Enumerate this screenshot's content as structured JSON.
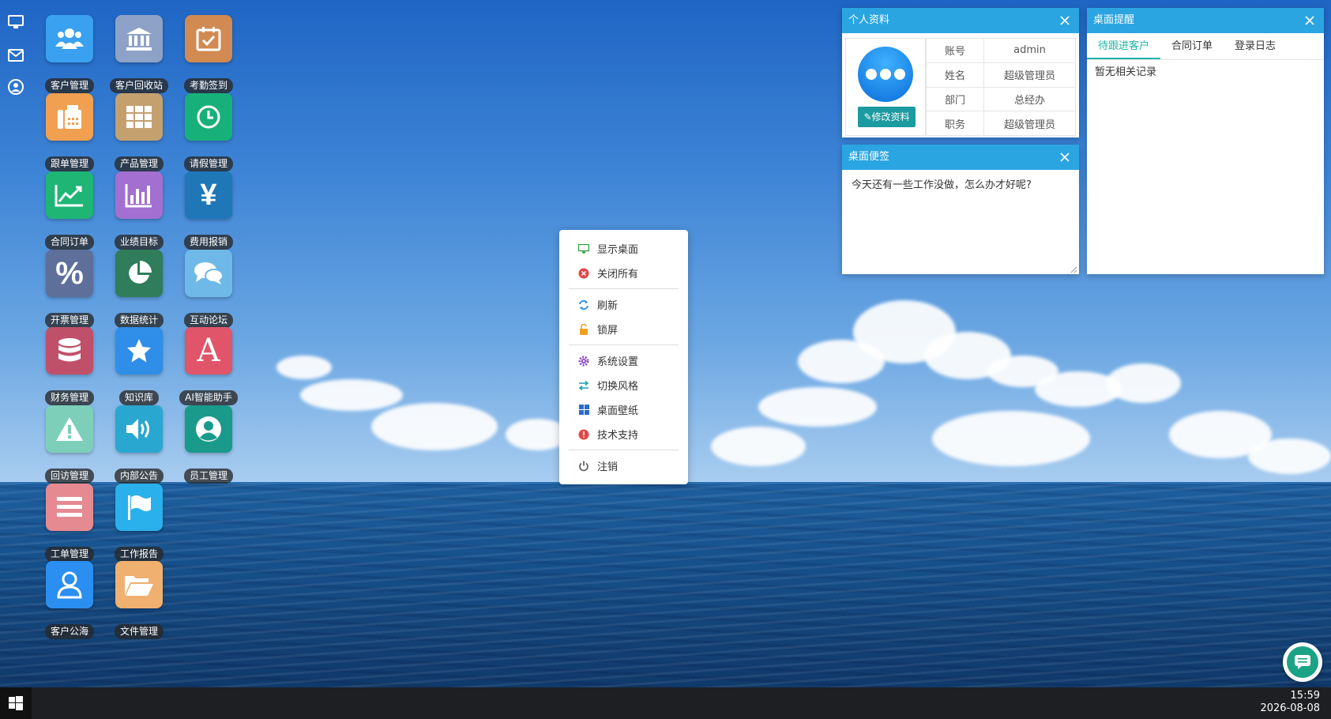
{
  "desktop": {
    "icons": [
      {
        "label": "客户管理",
        "icon": "users-icon",
        "color": "#3aa0f0"
      },
      {
        "label": "客户回收站",
        "icon": "bank-icon",
        "color": "#8ea2c7"
      },
      {
        "label": "考勤签到",
        "icon": "calendar-check-icon",
        "color": "#d08a52"
      },
      {
        "label": "跟单管理",
        "icon": "fax-icon",
        "color": "#f0a050"
      },
      {
        "label": "产品管理",
        "icon": "grid-icon",
        "color": "#c4a06f"
      },
      {
        "label": "请假管理",
        "icon": "clock-icon",
        "color": "#18b07a"
      },
      {
        "label": "合同订单",
        "icon": "line-chart-icon",
        "color": "#1fb575"
      },
      {
        "label": "业绩目标",
        "icon": "bar-chart-icon",
        "color": "#a36fd0"
      },
      {
        "label": "费用报销",
        "icon": "yen-icon",
        "color": "#1f77b8"
      },
      {
        "label": "开票管理",
        "icon": "percent-icon",
        "color": "#5e6f9a"
      },
      {
        "label": "数据统计",
        "icon": "pie-chart-icon",
        "color": "#2f7d5a"
      },
      {
        "label": "互动论坛",
        "icon": "chat-bubbles-icon",
        "color": "#6fb9e8"
      },
      {
        "label": "财务管理",
        "icon": "database-icon",
        "color": "#c0506a"
      },
      {
        "label": "知识库",
        "icon": "star-icon",
        "color": "#2f8ee8"
      },
      {
        "label": "AI智能助手",
        "icon": "letter-a-icon",
        "color": "#e0556a"
      },
      {
        "label": "回访管理",
        "icon": "warning-icon",
        "color": "#7ecfb9"
      },
      {
        "label": "内部公告",
        "icon": "speaker-icon",
        "color": "#2aa7d0"
      },
      {
        "label": "员工管理",
        "icon": "user-circle-icon",
        "color": "#1a9a8a"
      },
      {
        "label": "工单管理",
        "icon": "list-icon",
        "color": "#e58a90"
      },
      {
        "label": "工作报告",
        "icon": "flag-icon",
        "color": "#2ab0ea"
      },
      {
        "label": "客户公海",
        "icon": "user-outline-icon",
        "color": "#2a8ff0"
      },
      {
        "label": "文件管理",
        "icon": "folder-open-icon",
        "color": "#f0b070"
      }
    ]
  },
  "minibar": [
    "monitor-icon",
    "envelope-icon",
    "user-circle-icon"
  ],
  "profile": {
    "title": "个人资料",
    "edit_label": "修改资料",
    "rows": [
      {
        "k": "账号",
        "v": "admin"
      },
      {
        "k": "姓名",
        "v": "超级管理员"
      },
      {
        "k": "部门",
        "v": "总经办"
      },
      {
        "k": "职务",
        "v": "超级管理员"
      }
    ]
  },
  "note": {
    "title": "桌面便签",
    "text": "今天还有一些工作没做，怎么办才好呢?"
  },
  "reminder": {
    "title": "桌面提醒",
    "tabs": [
      "待跟进客户",
      "合同订单",
      "登录日志"
    ],
    "empty": "暂无相关记录"
  },
  "context_menu": {
    "groups": [
      [
        {
          "label": "显示桌面",
          "icon": "monitor-icon"
        },
        {
          "label": "关闭所有",
          "icon": "close-circle-icon"
        }
      ],
      [
        {
          "label": "刷新",
          "icon": "refresh-icon"
        },
        {
          "label": "锁屏",
          "icon": "lock-icon"
        }
      ],
      [
        {
          "label": "系统设置",
          "icon": "gear-icon"
        },
        {
          "label": "切换风格",
          "icon": "swap-icon"
        },
        {
          "label": "桌面壁纸",
          "icon": "windows-grid-icon"
        },
        {
          "label": "技术支持",
          "icon": "alert-circle-icon"
        }
      ],
      [
        {
          "label": "注销",
          "icon": "power-icon"
        }
      ]
    ]
  },
  "taskbar": {
    "time": "15:59",
    "date": "2026-08-08"
  }
}
